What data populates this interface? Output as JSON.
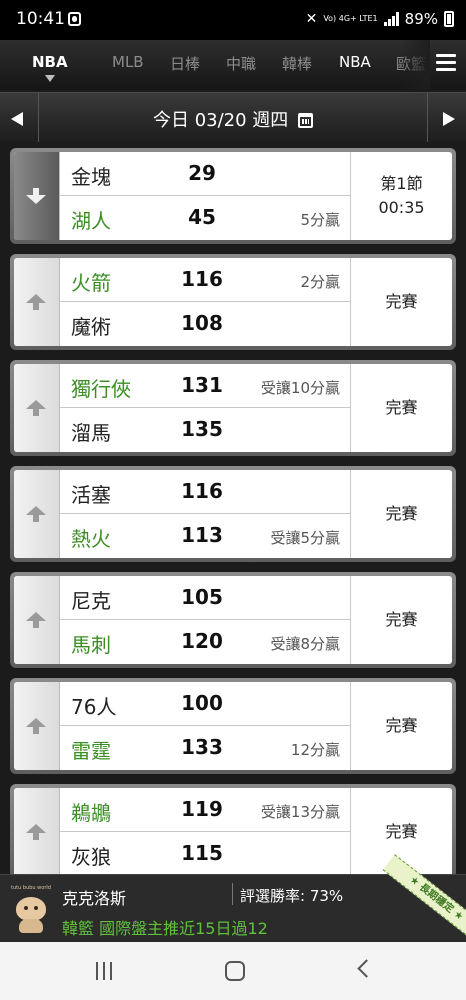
{
  "status_bar": {
    "time": "10:41",
    "network": "Vo) 4G+ LTE1",
    "battery": "89%"
  },
  "league_tabs": [
    {
      "label": "NBA",
      "active": true
    },
    {
      "label": "MLB",
      "active": false
    },
    {
      "label": "日棒",
      "active": false
    },
    {
      "label": "中職",
      "active": false
    },
    {
      "label": "韓棒",
      "active": false
    },
    {
      "label": "NBA",
      "active": false
    },
    {
      "label": "歐籃",
      "active": false
    }
  ],
  "date_bar": {
    "date": "今日 03/20 週四"
  },
  "games": [
    {
      "live": true,
      "status_line1": "第1節",
      "status_line2": "00:35",
      "team1": {
        "name": "金塊",
        "score": "29",
        "spread": "",
        "winner": false
      },
      "team2": {
        "name": "湖人",
        "score": "45",
        "spread": "5分贏",
        "winner": true
      }
    },
    {
      "live": false,
      "status_line1": "完賽",
      "status_line2": "",
      "team1": {
        "name": "火箭",
        "score": "116",
        "spread": "2分贏",
        "winner": true
      },
      "team2": {
        "name": "魔術",
        "score": "108",
        "spread": "",
        "winner": false
      }
    },
    {
      "live": false,
      "status_line1": "完賽",
      "status_line2": "",
      "team1": {
        "name": "獨行俠",
        "score": "131",
        "spread": "受讓10分贏",
        "winner": true
      },
      "team2": {
        "name": "溜馬",
        "score": "135",
        "spread": "",
        "winner": false
      }
    },
    {
      "live": false,
      "status_line1": "完賽",
      "status_line2": "",
      "team1": {
        "name": "活塞",
        "score": "116",
        "spread": "",
        "winner": false
      },
      "team2": {
        "name": "熱火",
        "score": "113",
        "spread": "受讓5分贏",
        "winner": true
      }
    },
    {
      "live": false,
      "status_line1": "完賽",
      "status_line2": "",
      "team1": {
        "name": "尼克",
        "score": "105",
        "spread": "",
        "winner": false
      },
      "team2": {
        "name": "馬刺",
        "score": "120",
        "spread": "受讓8分贏",
        "winner": true
      }
    },
    {
      "live": false,
      "status_line1": "完賽",
      "status_line2": "",
      "team1": {
        "name": "76人",
        "score": "100",
        "spread": "",
        "winner": false
      },
      "team2": {
        "name": "雷霆",
        "score": "133",
        "spread": "12分贏",
        "winner": true
      }
    },
    {
      "live": false,
      "status_line1": "完賽",
      "status_line2": "",
      "team1": {
        "name": "鵜鶘",
        "score": "119",
        "spread": "受讓13分贏",
        "winner": true
      },
      "team2": {
        "name": "灰狼",
        "score": "115",
        "spread": "",
        "winner": false
      }
    }
  ],
  "banner": {
    "avatar_caption": "tutu bubu world",
    "expert_name": "克克洛斯",
    "win_rate": "評選勝率: 73%",
    "pick_text": "韓籃 國際盤主推近15日過12",
    "ribbon_text": "★ 長期穩定 ★"
  },
  "colors": {
    "winner_green": "#3c8f25",
    "pick_green": "#5fc23a"
  }
}
